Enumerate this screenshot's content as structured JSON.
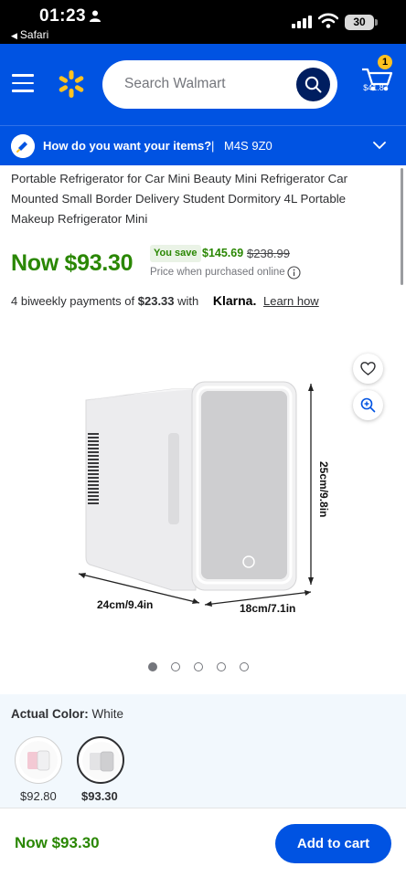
{
  "status": {
    "time": "01:23",
    "back_app": "Safari",
    "battery": "30"
  },
  "header": {
    "search_placeholder": "Search Walmart",
    "cart_count": "1",
    "cart_total": "$41.87"
  },
  "fulfillment": {
    "question": "How do you want your items?",
    "separator": "|",
    "postal_code": "M4S 9Z0"
  },
  "product": {
    "title": "Portable Refrigerator for Car Mini Beauty Mini Refrigerator Car Mounted Small Border Delivery Student Dormitory 4L Portable Makeup Refrigerator Mini",
    "now_price": "Now $93.30",
    "you_save_label": "You save",
    "save_amount": "$145.69",
    "was_price": "$238.99",
    "price_note": "Price when purchased online",
    "klarna": {
      "prefix": "4 biweekly payments of",
      "amount": "$23.33",
      "with": "with",
      "brand": "Klarna.",
      "learn": "Learn how"
    },
    "dimensions": {
      "width": "24cm/9.4in",
      "depth": "18cm/7.1in",
      "height": "25cm/9.8in"
    },
    "image_count": 5,
    "active_image": 1
  },
  "colors": {
    "label": "Actual Color:",
    "selected": "White",
    "options": [
      {
        "name": "pink",
        "price": "$92.80"
      },
      {
        "name": "white",
        "price": "$93.30"
      }
    ]
  },
  "bottom_bar": {
    "price": "Now $93.30",
    "add_to_cart": "Add to cart"
  },
  "theme": {
    "brand_blue": "#0053e2",
    "spark_yellow": "#ffc220",
    "price_green": "#2a8703",
    "navy": "#001e60"
  },
  "icons": [
    "person-icon",
    "signal-icon",
    "wifi-icon",
    "battery-icon",
    "hamburger-icon",
    "spark-logo-icon",
    "search-icon",
    "cart-icon",
    "delivery-icon",
    "chevron-down-icon",
    "info-icon",
    "heart-icon",
    "zoom-icon"
  ]
}
